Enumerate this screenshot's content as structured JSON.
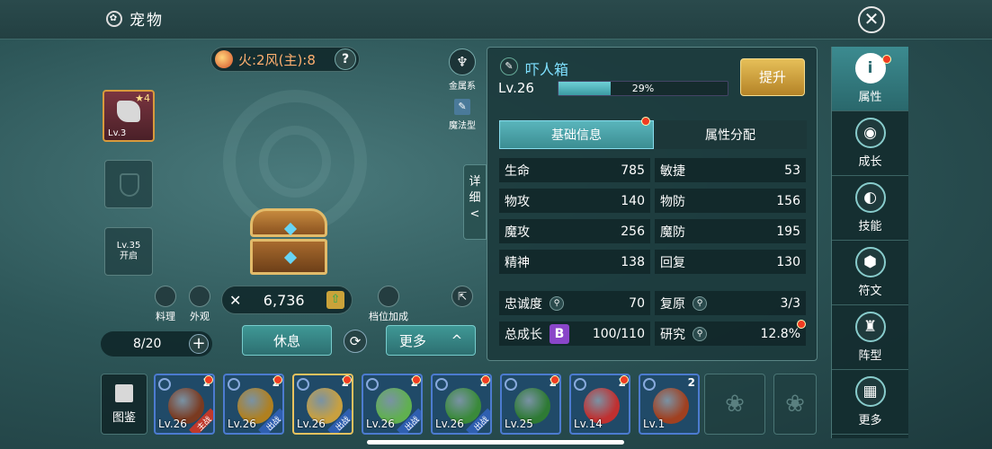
{
  "header": {
    "icon": "gear-flower-icon",
    "title": "宠物",
    "close_icon": "close-icon"
  },
  "element": {
    "text": "火:2风(主):8",
    "hint": "?"
  },
  "type_tags": [
    {
      "label": "金属系",
      "icon": "metal-icon"
    },
    {
      "label": "魔法型",
      "icon": "wand-icon"
    }
  ],
  "equip_slots": {
    "item_level": "Lv.3",
    "item_stars": "★4",
    "locked_label": "Lv.35\n开启",
    "locked_level": "Lv.35",
    "locked_text": "开启"
  },
  "detail_tab": {
    "label1": "详",
    "label2": "细",
    "arrow": "<"
  },
  "actions": {
    "cook": "料理",
    "skin": "外观",
    "slot_bonus": "档位加成"
  },
  "power": {
    "value": "6,736"
  },
  "capacity": {
    "text": "8/20",
    "plus": "+"
  },
  "buttons": {
    "rest": "休息",
    "more": "更多",
    "more_arrow": "^"
  },
  "pet": {
    "name": "吓人箱",
    "level": "Lv.26",
    "xp_percent": "29%",
    "xp_fraction": 0.29,
    "upgrade": "提升"
  },
  "tabs": [
    "基础信息",
    "属性分配"
  ],
  "stats": [
    {
      "l": "生命",
      "lv": "785",
      "r": "敏捷",
      "rv": "53"
    },
    {
      "l": "物攻",
      "lv": "140",
      "r": "物防",
      "rv": "156"
    },
    {
      "l": "魔攻",
      "lv": "256",
      "r": "魔防",
      "rv": "195"
    },
    {
      "l": "精神",
      "lv": "138",
      "r": "回复",
      "rv": "130"
    }
  ],
  "extra": {
    "loyalty_label": "忠诚度",
    "loyalty_value": "70",
    "revive_label": "复原",
    "revive_value": "3/3",
    "growth_label": "总成长",
    "growth_grade": "B",
    "growth_value": "100/110",
    "research_label": "研究",
    "research_value": "12.8%"
  },
  "right_menu": [
    {
      "label": "属性",
      "icon": "info-icon",
      "glyph": "i"
    },
    {
      "label": "成长",
      "icon": "growth-icon",
      "glyph": "◉"
    },
    {
      "label": "技能",
      "icon": "skill-icon",
      "glyph": "◐"
    },
    {
      "label": "符文",
      "icon": "rune-icon",
      "glyph": "⬢"
    },
    {
      "label": "阵型",
      "icon": "formation-icon",
      "glyph": "♜"
    },
    {
      "label": "更多",
      "icon": "grid-icon",
      "glyph": "▦"
    }
  ],
  "dex": {
    "label": "图鉴",
    "icon": "book-icon"
  },
  "roster": [
    {
      "level": "Lv.26",
      "stars": "2",
      "tag": "主战",
      "color": "#7a3a20"
    },
    {
      "level": "Lv.26",
      "stars": "2",
      "tag": "出战",
      "color": "#b08020"
    },
    {
      "level": "Lv.26",
      "stars": "2",
      "tag": "出战",
      "color": "#c8a040"
    },
    {
      "level": "Lv.26",
      "stars": "2",
      "tag": "出战",
      "color": "#60b050"
    },
    {
      "level": "Lv.26",
      "stars": "2",
      "tag": "出战",
      "color": "#3a8a3a"
    },
    {
      "level": "Lv.25",
      "stars": "2",
      "tag": "",
      "color": "#2e7a34"
    },
    {
      "level": "Lv.14",
      "stars": "2",
      "tag": "",
      "color": "#c03030"
    },
    {
      "level": "Lv.1",
      "stars": "2",
      "tag": "",
      "color": "#a04020"
    }
  ],
  "empty_slot_icon": "paw-icon",
  "colors": {
    "accent": "#3b9aa2",
    "gold": "#e6bf58",
    "red_dot": "#f03c22",
    "main_tag": "#c0392b",
    "out_tag": "#2f5fb0"
  }
}
